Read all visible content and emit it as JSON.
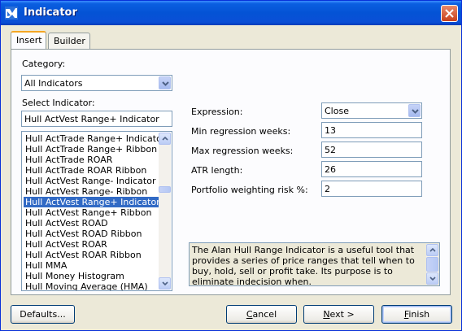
{
  "window": {
    "title": "Indicator"
  },
  "tabs": [
    {
      "label": "Insert"
    },
    {
      "label": "Builder"
    }
  ],
  "category": {
    "label": "Category:",
    "value": "All Indicators"
  },
  "select_indicator": {
    "label": "Select Indicator:",
    "value": "Hull ActVest Range+ Indicator",
    "items": [
      "Hull ActTrade Range+ Indicator",
      "Hull ActTrade Range+ Ribbon",
      "Hull ActTrade ROAR",
      "Hull ActTrade ROAR Ribbon",
      "Hull ActVest Range- Indicator",
      "Hull ActVest Range- Ribbon",
      "Hull ActVest Range+ Indicator",
      "Hull ActVest Range+ Ribbon",
      "Hull ActVest ROAD",
      "Hull ActVest ROAD Ribbon",
      "Hull ActVest ROAR",
      "Hull ActVest ROAR Ribbon",
      "Hull MMA",
      "Hull Money Histogram",
      "Hull Moving Average (HMA)"
    ],
    "selected_item": "Hull ActVest Range+ Indicator"
  },
  "params": {
    "expression": {
      "label": "Expression:",
      "value": "Close"
    },
    "min_regression_weeks": {
      "label": "Min regression weeks:",
      "value": "13"
    },
    "max_regression_weeks": {
      "label": "Max regression weeks:",
      "value": "52"
    },
    "atr_length": {
      "label": "ATR length:",
      "value": "26"
    },
    "portfolio_weighting_risk": {
      "label": "Portfolio weighting risk %:",
      "value": "2"
    }
  },
  "description": {
    "text": "The Alan Hull Range Indicator is a useful tool that provides a series of price ranges that tell when to buy, hold, sell or profit take.  Its purpose is to eliminate indecision when."
  },
  "buttons": {
    "defaults": "Defaults...",
    "cancel": {
      "mnemonic": "C",
      "rest": "ancel"
    },
    "next": {
      "mnemonic": "N",
      "rest": "ext >"
    },
    "finish": {
      "mnemonic": "F",
      "rest": "inish"
    }
  },
  "colors": {
    "titlebar": "#0453D5",
    "selection": "#316AC5",
    "tab_accent": "#F5A623",
    "close_button": "#C8401C"
  },
  "icons": {
    "app": "indicator-app-icon",
    "close": "close-icon",
    "combo_arrow": "chevron-down-icon"
  }
}
